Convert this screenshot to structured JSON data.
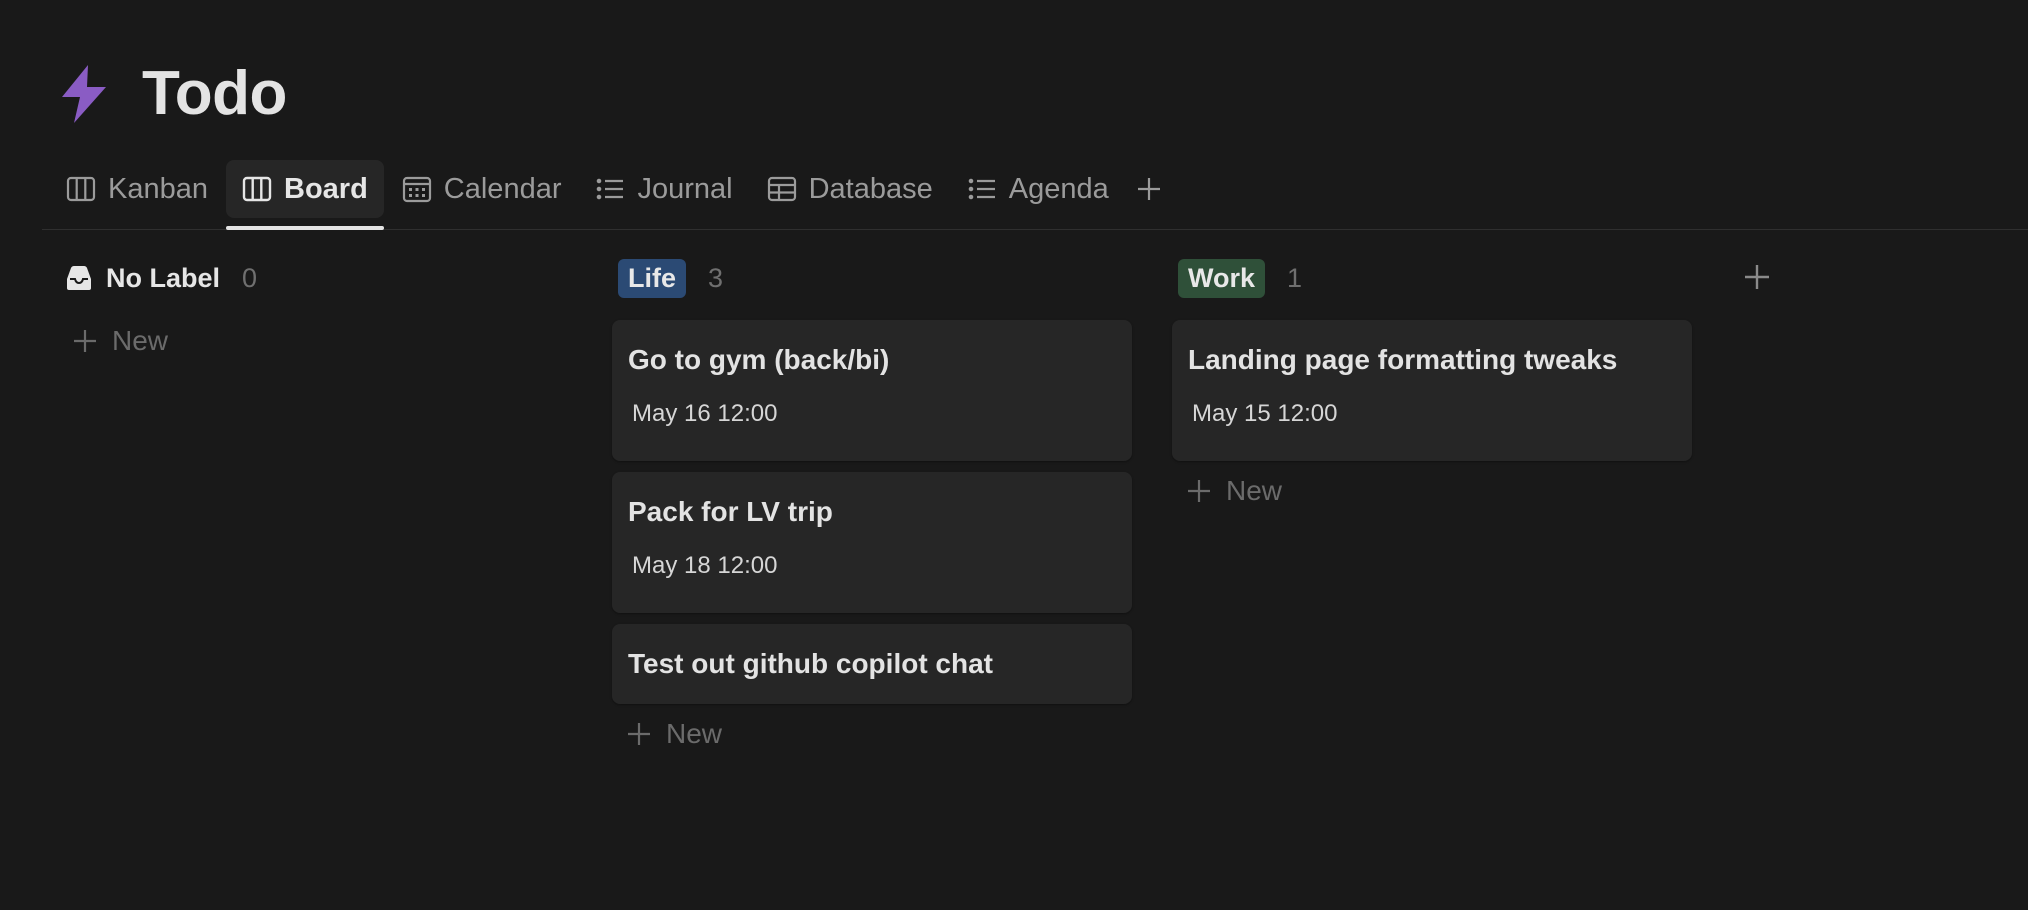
{
  "page": {
    "title": "Todo",
    "icon": "lightning-bolt-icon",
    "icon_color": "#8a5cc4"
  },
  "tabs": [
    {
      "label": "Kanban",
      "icon": "board-icon"
    },
    {
      "label": "Board",
      "icon": "board-icon",
      "active": true
    },
    {
      "label": "Calendar",
      "icon": "calendar-icon"
    },
    {
      "label": "Journal",
      "icon": "list-icon"
    },
    {
      "label": "Database",
      "icon": "table-icon"
    },
    {
      "label": "Agenda",
      "icon": "list-icon"
    }
  ],
  "columns": {
    "no_label": {
      "label": "No Label",
      "count": "0",
      "new_label": "New"
    },
    "life": {
      "label": "Life",
      "count": "3",
      "color": "#2b4a74",
      "new_label": "New",
      "cards": [
        {
          "title": "Go to gym (back/bi)",
          "date": "May 16 12:00"
        },
        {
          "title": "Pack for LV trip",
          "date": "May 18 12:00"
        },
        {
          "title": "Test out github copilot chat"
        }
      ]
    },
    "work": {
      "label": "Work",
      "count": "1",
      "color": "#2f5039",
      "new_label": "New",
      "cards": [
        {
          "title": "Landing page formatting tweaks",
          "date": "May 15 12:00"
        }
      ]
    }
  }
}
